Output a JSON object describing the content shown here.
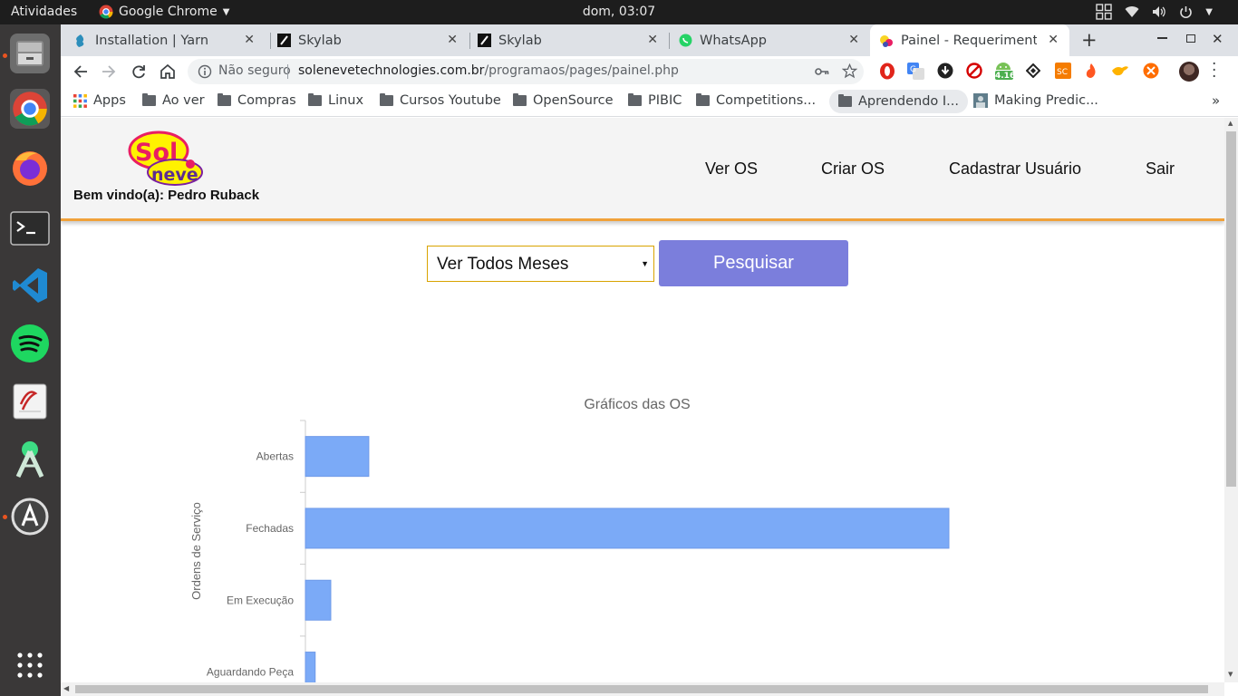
{
  "os": {
    "activities": "Atividades",
    "app_name": "Google Chrome",
    "clock": "dom, 03:07"
  },
  "tabs": [
    {
      "title": "Installation | Yarn",
      "icon": "yarn-icon"
    },
    {
      "title": "Skylab",
      "icon": "skylab-icon"
    },
    {
      "title": "Skylab",
      "icon": "skylab-icon"
    },
    {
      "title": "WhatsApp",
      "icon": "whatsapp-icon"
    },
    {
      "title": "Painel - Requerimento d",
      "icon": "solneve-icon",
      "active": true
    }
  ],
  "omnibox": {
    "security": "Não seguro",
    "domain": "solenevetechnologies.com.br",
    "path": "/programaos/pages/painel.php"
  },
  "extensions": {
    "badge": "4.16"
  },
  "bookmarks": [
    "Apps",
    "Ao ver",
    "Compras",
    "Linux",
    "Cursos Youtube",
    "OpenSource",
    "PIBIC",
    "Competitions...",
    "Aprendendo I...",
    "Making Predic..."
  ],
  "site": {
    "logo_text": "Sol neve",
    "welcome": "Bem vindo(a): Pedro Ruback",
    "nav": [
      "Ver OS",
      "Criar OS",
      "Cadastrar Usuário",
      "Sair"
    ],
    "filter_selected": "Ver Todos Meses",
    "search_label": "Pesquisar"
  },
  "chart_data": {
    "type": "bar",
    "orientation": "horizontal",
    "title": "Gráficos das OS",
    "ylabel": "Ordens de Serviço",
    "categories": [
      "Abertas",
      "Fechadas",
      "Em Execução",
      "Aguardando Peça"
    ],
    "values": [
      6.5,
      66,
      2.6,
      1
    ],
    "bar_color": "#7baaf7"
  }
}
